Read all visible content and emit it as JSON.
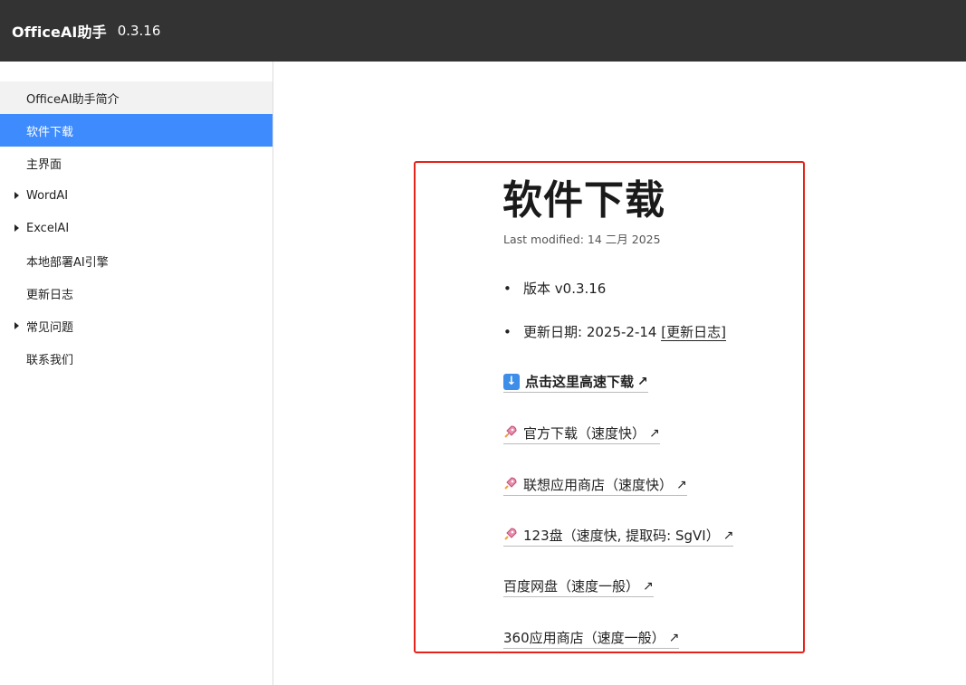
{
  "header": {
    "brand": "OfficeAI助手",
    "version": "0.3.16"
  },
  "sidebar": {
    "items": [
      {
        "label": "OfficeAI助手简介"
      },
      {
        "label": "软件下载"
      },
      {
        "label": "主界面"
      },
      {
        "label": "WordAI"
      },
      {
        "label": "ExcelAI"
      },
      {
        "label": "本地部署AI引擎"
      },
      {
        "label": "更新日志"
      },
      {
        "label": "常见问题"
      },
      {
        "label": "联系我们"
      }
    ]
  },
  "main": {
    "title": "软件下载",
    "last_modified": "Last modified: 14 二月 2025",
    "bullets": [
      {
        "text": "版本 v0.3.16"
      },
      {
        "text": "更新日期: 2025-2-14 ",
        "link": "[更新日志]"
      }
    ],
    "links": [
      {
        "label": "点击这里高速下载",
        "icon": "download-icon",
        "arrow": "↗"
      },
      {
        "label": "官方下载（速度快）",
        "icon": "rocket-icon",
        "arrow": "↗"
      },
      {
        "label": "联想应用商店（速度快）",
        "icon": "rocket-icon",
        "arrow": "↗"
      },
      {
        "label": "123盘（速度快, 提取码: SgVI）",
        "icon": "rocket-icon",
        "arrow": "↗"
      },
      {
        "label": "百度网盘（速度一般）",
        "arrow": "↗"
      },
      {
        "label": "360应用商店（速度一般）",
        "arrow": "↗"
      }
    ]
  },
  "colors": {
    "topbar": "#333333",
    "active": "#3d8bfd",
    "highlight_border": "#e5231b"
  }
}
